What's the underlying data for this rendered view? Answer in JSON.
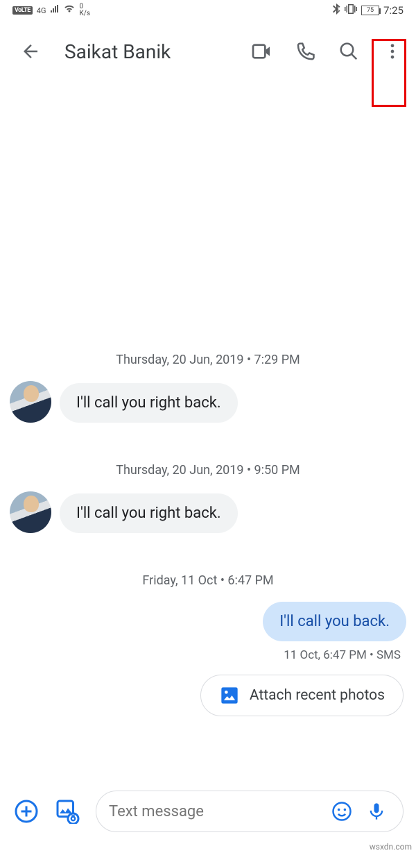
{
  "status_bar": {
    "volte": "VoLTE",
    "net_gen": "4G",
    "speed": "0",
    "speed_unit": "K/s",
    "battery": "75",
    "time": "7:25"
  },
  "header": {
    "contact_name": "Saikat Banik"
  },
  "conversation": {
    "block1": {
      "timestamp": "Thursday, 20 Jun, 2019 • 7:29 PM",
      "message": "I'll call you right back."
    },
    "block2": {
      "timestamp": "Thursday, 20 Jun, 2019 • 9:50 PM",
      "message": "I'll call you right back."
    },
    "block3": {
      "timestamp": "Friday, 11 Oct • 6:47 PM",
      "message": "I'll call you back.",
      "meta": "11 Oct, 6:47 PM • SMS"
    }
  },
  "attach_chip": {
    "label": "Attach recent photos"
  },
  "compose": {
    "placeholder": "Text message"
  },
  "watermark": "wsxdn.com"
}
